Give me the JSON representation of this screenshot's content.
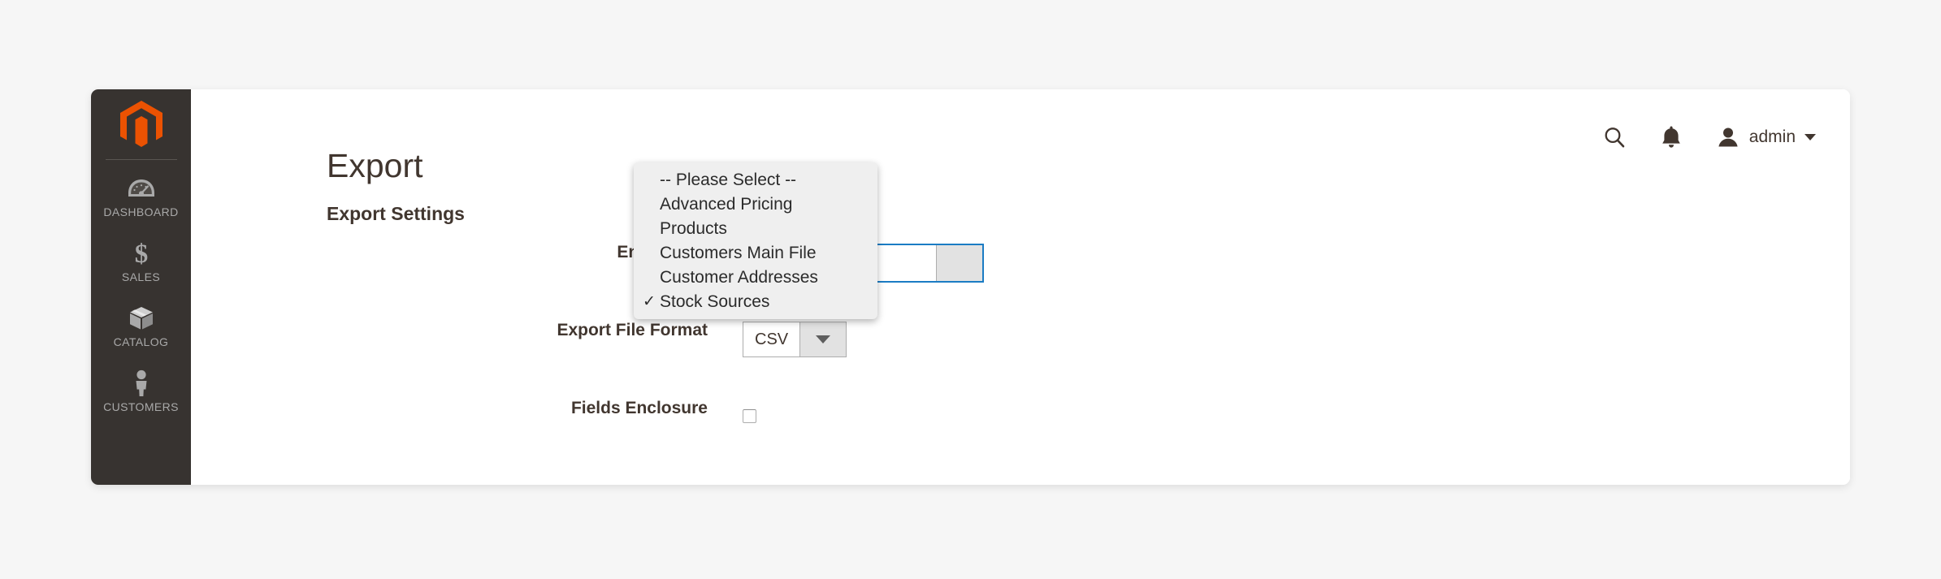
{
  "app": {
    "background_color": "#f6f6f6",
    "card_background": "#ffffff",
    "sidebar_color": "#373330",
    "accent_color": "#eb5202",
    "focus_color": "#1b7cc4",
    "text_color": "#41362f"
  },
  "sidebar": {
    "logo": "magento-logo-icon",
    "items": [
      {
        "label": "DASHBOARD",
        "icon": "dashboard-gauge-icon"
      },
      {
        "label": "SALES",
        "icon": "dollar-sign-icon"
      },
      {
        "label": "CATALOG",
        "icon": "box-package-icon"
      },
      {
        "label": "CUSTOMERS",
        "icon": "person-icon"
      }
    ]
  },
  "header": {
    "title": "Export",
    "search_icon": "search-icon",
    "notifications_icon": "bell-icon",
    "account": {
      "avatar_icon": "user-avatar-icon",
      "name": "admin",
      "caret_icon": "chevron-down-icon"
    }
  },
  "main": {
    "section_heading": "Export Settings",
    "fields": [
      {
        "label": "Entity Type",
        "control": "select",
        "value": "",
        "focused": true
      },
      {
        "label": "Export File Format",
        "control": "select",
        "value": "CSV",
        "focused": false
      },
      {
        "label": "Fields Enclosure",
        "control": "checkbox",
        "checked": false
      }
    ]
  },
  "entity_type_dropdown": {
    "open": true,
    "options": [
      {
        "label": "-- Please Select --",
        "selected": false
      },
      {
        "label": "Advanced Pricing",
        "selected": false
      },
      {
        "label": "Products",
        "selected": false
      },
      {
        "label": "Customers Main File",
        "selected": false
      },
      {
        "label": "Customer Addresses",
        "selected": false
      },
      {
        "label": "Stock Sources",
        "selected": true
      }
    ]
  }
}
